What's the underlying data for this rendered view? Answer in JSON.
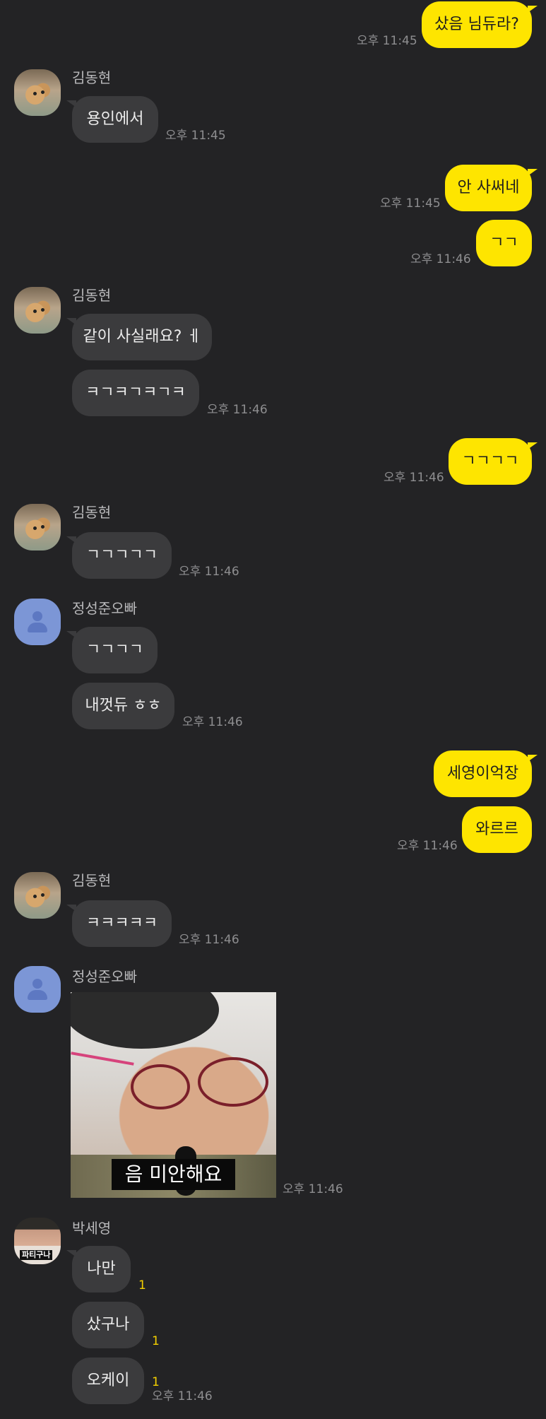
{
  "messages": [
    {
      "text": "샀음 님듀라?",
      "time": "오후 11:45"
    },
    {
      "sender": "김동현",
      "text": "용인에서",
      "time": "오후 11:45"
    },
    {
      "text": "안 사써네",
      "time": "오후 11:45"
    },
    {
      "text": "ㄱㄱ",
      "time": "오후 11:46"
    },
    {
      "sender": "김동현",
      "text": "같이 사실래요? ㅔ"
    },
    {
      "text": "ㅋㄱㅋㄱㅋㄱㅋ",
      "time": "오후 11:46"
    },
    {
      "text": "ㄱㄱㄱㄱ",
      "time": "오후 11:46"
    },
    {
      "sender": "김동현",
      "text": "ㄱㄱㄱㄱㄱ",
      "time": "오후 11:46"
    },
    {
      "sender": "정성준오빠",
      "text": "ㄱㄱㄱㄱ"
    },
    {
      "text": "내껏듀 ㅎㅎ",
      "time": "오후 11:46"
    },
    {
      "text": "세영이억장"
    },
    {
      "text": "와르르",
      "time": "오후 11:46"
    },
    {
      "sender": "김동현",
      "text": "ㅋㅋㅋㅋㅋ",
      "time": "오후 11:46"
    },
    {
      "sender": "정성준오빠",
      "image_caption": "음 미안해요",
      "time": "오후 11:46"
    },
    {
      "sender": "박세영",
      "text": "나만",
      "unread": "1"
    },
    {
      "text": "샀구나",
      "unread": "1"
    },
    {
      "text": "오케이",
      "unread": "1",
      "time": "오후 11:46"
    }
  ],
  "avatar_badge": "파티구나",
  "colors": {
    "background": "#232325",
    "outgoing_bubble": "#fee500",
    "incoming_bubble": "#3b3b3d",
    "unread": "#f5d000"
  }
}
